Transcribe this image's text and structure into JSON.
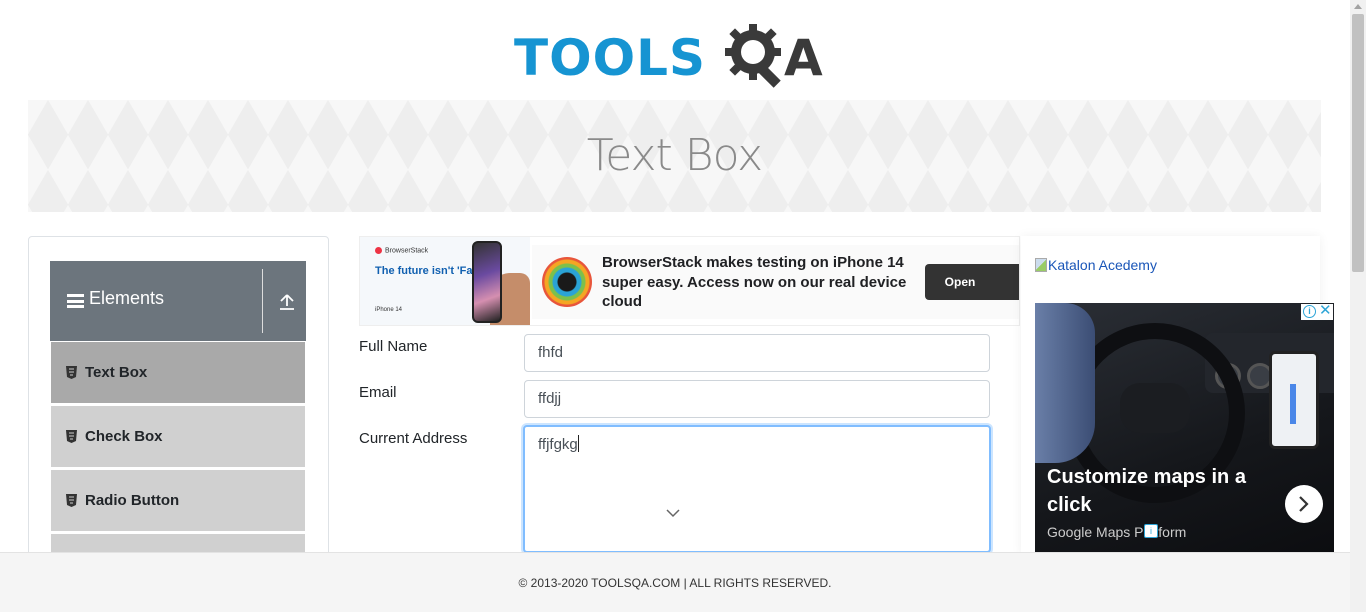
{
  "header": {
    "logo_text_primary": "TOOLS",
    "logo_text_secondary": "QA"
  },
  "page": {
    "title": "Text Box"
  },
  "sidebar": {
    "group_title": "Elements",
    "items": [
      {
        "label": "Text Box",
        "active": true
      },
      {
        "label": "Check Box",
        "active": false
      },
      {
        "label": "Radio Button",
        "active": false
      }
    ]
  },
  "ad_top": {
    "brand": "BrowserStack",
    "tagline": "The future isn't 'Far Out'",
    "iphone_tag": "iPhone 14",
    "message": "BrowserStack makes testing on iPhone 14 super easy. Access now on our real device cloud",
    "button": "Open"
  },
  "form": {
    "full_name_label": "Full Name",
    "full_name_value": "fhfd",
    "email_label": "Email",
    "email_value": "ffdjj",
    "address_label": "Current Address",
    "address_value": "ffjfgkg"
  },
  "ad_right": {
    "katalon_alt": "Katalon Acedemy",
    "maps_headline": "Customize maps in a click",
    "maps_brand": "Google Maps Platform"
  },
  "footer": {
    "copyright": "© 2013-2020 TOOLSQA.COM | ALL RIGHTS RESERVED."
  },
  "colors": {
    "brand_blue": "#1694d2",
    "brand_dark": "#3a3a3a",
    "sidebar_header": "#6c757d",
    "active_item": "#a9a9a9",
    "focus_border": "#80bdff"
  }
}
